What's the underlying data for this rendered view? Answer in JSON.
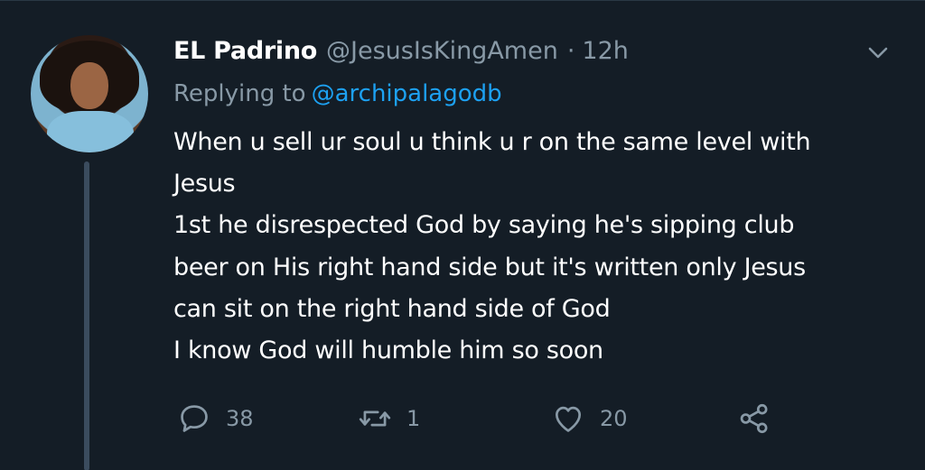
{
  "tweet": {
    "display_name": "EL Padrino",
    "handle": "@JesusIsKingAmen",
    "separator": "·",
    "time": "12h",
    "replying_prefix": "Replying to",
    "replying_to": "@archipalagodb",
    "text_lines": [
      "When u sell ur soul u think u r on the same level with",
      "Jesus",
      "1st he disrespected God  by saying he's sipping club",
      "beer on His right hand side but it's written only Jesus",
      "can sit on the right hand side of God",
      "I know God will humble him so soon"
    ]
  },
  "actions": {
    "reply": {
      "icon": "reply-icon",
      "count": "38"
    },
    "retweet": {
      "icon": "retweet-icon",
      "count": "1"
    },
    "like": {
      "icon": "heart-icon",
      "count": "20"
    },
    "share": {
      "icon": "share-icon"
    }
  },
  "colors": {
    "background": "#141d26",
    "primary_text": "#ffffff",
    "secondary_text": "#8899a6",
    "mention": "#1da1f2",
    "thread_line": "#3b4c5e"
  }
}
